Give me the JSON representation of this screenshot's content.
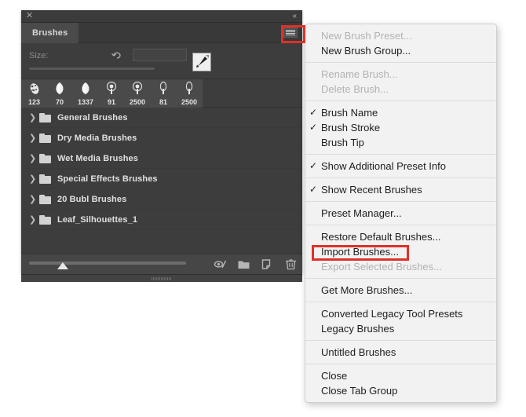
{
  "panel": {
    "close_icon": "close-icon",
    "collapse_icon": "double-chevron-left-icon",
    "tab_label": "Brushes",
    "menu_button_icon": "hamburger-menu-icon",
    "size": {
      "label": "Size:",
      "reset_icon": "reset-arrow-icon",
      "value": "",
      "placeholder": "",
      "tool_icon": "brush-tool-icon"
    },
    "recent_brushes": [
      {
        "count": "123",
        "glyph": "speckled-leaf-brush"
      },
      {
        "count": "70",
        "glyph": "leaf-brush"
      },
      {
        "count": "1337",
        "glyph": "leaf-brush"
      },
      {
        "count": "91",
        "glyph": "soft-round-brush"
      },
      {
        "count": "2500",
        "glyph": "soft-round-brush"
      },
      {
        "count": "81",
        "glyph": "hard-round-brush"
      },
      {
        "count": "2500",
        "glyph": "hard-round-brush"
      }
    ],
    "brush_groups": [
      {
        "name": "General Brushes"
      },
      {
        "name": "Dry Media Brushes"
      },
      {
        "name": "Wet Media Brushes"
      },
      {
        "name": "Special Effects Brushes"
      },
      {
        "name": "20 Bubl Brushes"
      },
      {
        "name": "Leaf_Silhouettes_1"
      }
    ],
    "footer_icons": [
      "toggle-brush-preview-icon",
      "new-group-icon",
      "new-brush-icon",
      "delete-brush-icon"
    ]
  },
  "flyout_menu": {
    "items": [
      {
        "label": "New Brush Preset...",
        "checked": false,
        "disabled": true
      },
      {
        "label": "New Brush Group...",
        "checked": false,
        "disabled": false
      },
      {
        "separator": true
      },
      {
        "label": "Rename Brush...",
        "checked": false,
        "disabled": true
      },
      {
        "label": "Delete Brush...",
        "checked": false,
        "disabled": true
      },
      {
        "separator": true
      },
      {
        "label": "Brush Name",
        "checked": true,
        "disabled": false
      },
      {
        "label": "Brush Stroke",
        "checked": true,
        "disabled": false
      },
      {
        "label": "Brush Tip",
        "checked": false,
        "disabled": false
      },
      {
        "separator": true
      },
      {
        "label": "Show Additional Preset Info",
        "checked": true,
        "disabled": false
      },
      {
        "separator": true
      },
      {
        "label": "Show Recent Brushes",
        "checked": true,
        "disabled": false
      },
      {
        "separator": true
      },
      {
        "label": "Preset Manager...",
        "checked": false,
        "disabled": false
      },
      {
        "separator": true
      },
      {
        "label": "Restore Default Brushes...",
        "checked": false,
        "disabled": false
      },
      {
        "label": "Import Brushes...",
        "checked": false,
        "disabled": false,
        "highlighted": true
      },
      {
        "label": "Export Selected Brushes...",
        "checked": false,
        "disabled": true
      },
      {
        "separator": true
      },
      {
        "label": "Get More Brushes...",
        "checked": false,
        "disabled": false
      },
      {
        "separator": true
      },
      {
        "label": "Converted Legacy Tool Presets",
        "checked": false,
        "disabled": false
      },
      {
        "label": "Legacy Brushes",
        "checked": false,
        "disabled": false
      },
      {
        "separator": true
      },
      {
        "label": "Untitled Brushes",
        "checked": false,
        "disabled": false
      },
      {
        "separator": true
      },
      {
        "label": "Close",
        "checked": false,
        "disabled": false
      },
      {
        "label": "Close Tab Group",
        "checked": false,
        "disabled": false
      }
    ],
    "check_glyph": "✓"
  },
  "colors": {
    "panel_bg": "#3d3d3d",
    "tab_active_bg": "#4a4a4a",
    "menu_bg": "#f2f2f2",
    "highlight_red": "#e03028",
    "text_light": "#e0e0e0",
    "text_disabled": "#b2b2b2"
  }
}
